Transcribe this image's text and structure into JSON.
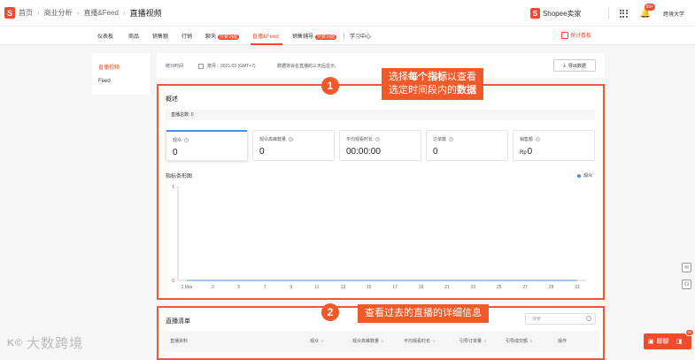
{
  "topbar": {
    "breadcrumb": [
      "首页",
      "商业分析",
      "直播&Feed"
    ],
    "current": "直播视频",
    "brand": "Shopee卖家",
    "notif_count": "99+",
    "user": "跨境大学"
  },
  "nav": {
    "items": [
      {
        "label": "仪表板"
      },
      {
        "label": "商品"
      },
      {
        "label": "销售额"
      },
      {
        "label": "行销"
      },
      {
        "label": "聊天",
        "badge": "付费功能"
      },
      {
        "label": "直播&Feed"
      },
      {
        "label": "销售辅导",
        "badge": "付费功能"
      },
      {
        "label": "学习中心"
      }
    ],
    "right_link": "探讨看板"
  },
  "sidebar": {
    "items": [
      "直播视频",
      "Feed"
    ]
  },
  "filter": {
    "label": "统计时间",
    "period": "按月：2021.03 (GMT+7)",
    "note": "数据将会在直播的三天后显示。",
    "export_label": "导出数据"
  },
  "overview": {
    "title": "概述",
    "total_label": "直播总数: 0",
    "metrics": [
      {
        "label": "观众",
        "value": "0"
      },
      {
        "label": "观众高峰数量",
        "value": "0"
      },
      {
        "label": "平均观看时长",
        "value": "00:00:00"
      },
      {
        "label": "订单数",
        "value": "0"
      },
      {
        "label": "销售额",
        "currency": "Rp",
        "value": "0"
      }
    ]
  },
  "chart_data": {
    "type": "line",
    "title": "指标条形图",
    "x": [
      "1 Mar",
      "3",
      "5",
      "7",
      "9",
      "11",
      "13",
      "15",
      "17",
      "19",
      "21",
      "23",
      "25",
      "27",
      "29",
      "31"
    ],
    "series": [
      {
        "name": "观众",
        "values": [
          0,
          0,
          0,
          0,
          0,
          0,
          0,
          0,
          0,
          0,
          0,
          0,
          0,
          0,
          0,
          0
        ]
      }
    ],
    "ylim": [
      0,
      1
    ],
    "yticks": [
      "0",
      "1"
    ],
    "grid": false,
    "legend": "top-right",
    "colors": {
      "series": "#4a90e2"
    }
  },
  "callouts": {
    "one": {
      "num": "1",
      "line1_a": "选择",
      "line1_b": "每个指标",
      "line1_c": "以查看",
      "line2_a": "选定时间段内的",
      "line2_b": "数据"
    },
    "two": {
      "num": "2",
      "text": "查看过去的直播的详细信息"
    }
  },
  "livelist": {
    "title": "直播清单",
    "search_placeholder": "搜索",
    "columns": [
      "直播资料",
      "观众",
      "观众高峰数量",
      "平均观看时长",
      "引导订单量",
      "引导成交额",
      "操作"
    ]
  },
  "float": {
    "chat_label": "聊聊",
    "chat_badge": "99"
  },
  "watermark": "大数跨境",
  "colors": {
    "brand": "#ee4d2d",
    "callout": "#f05a28",
    "accent": "#4a90e2"
  }
}
